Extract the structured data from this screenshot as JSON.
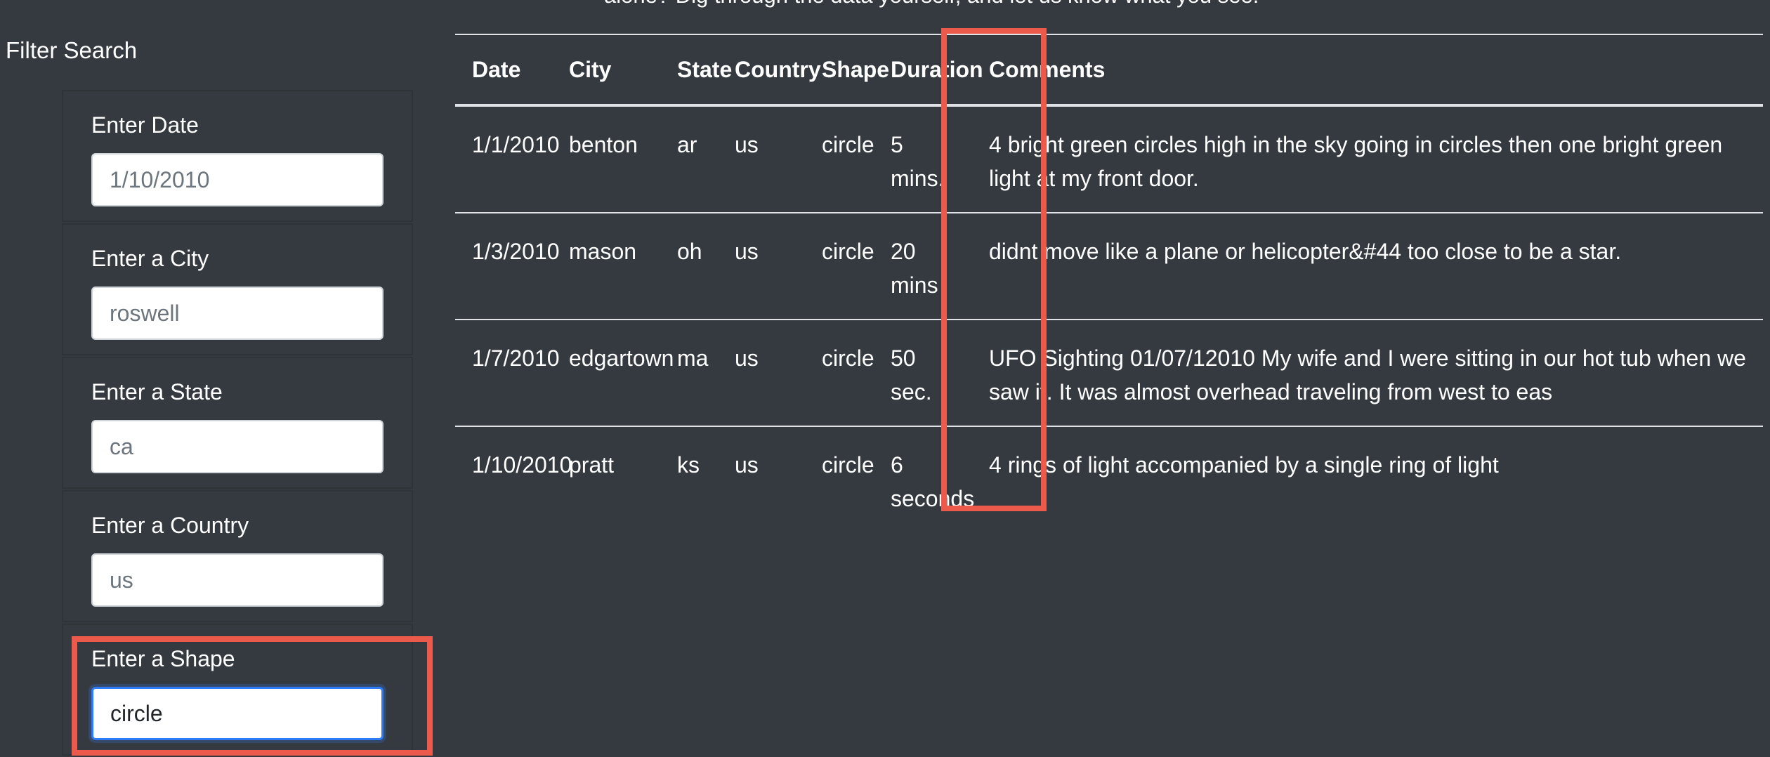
{
  "intro": {
    "partial_text": "alone? Dig through the data yourself, and let us know what you see."
  },
  "sidebar": {
    "title": "Filter Search",
    "filters": [
      {
        "label": "Enter Date",
        "placeholder": "1/10/2010",
        "value": ""
      },
      {
        "label": "Enter a City",
        "placeholder": "roswell",
        "value": ""
      },
      {
        "label": "Enter a State",
        "placeholder": "ca",
        "value": ""
      },
      {
        "label": "Enter a Country",
        "placeholder": "us",
        "value": ""
      },
      {
        "label": "Enter a Shape",
        "placeholder": "",
        "value": "circle"
      }
    ]
  },
  "table": {
    "headers": [
      "Date",
      "City",
      "State",
      "Country",
      "Shape",
      "Duration",
      "Comments"
    ],
    "rows": [
      [
        "1/1/2010",
        "benton",
        "ar",
        "us",
        "circle",
        "5 mins.",
        "4 bright green circles high in the sky going in circles then one bright green light at my front door."
      ],
      [
        "1/3/2010",
        "mason",
        "oh",
        "us",
        "circle",
        "20 mins",
        "didnt move like a plane or helicopter&#44 too close to be a star."
      ],
      [
        "1/7/2010",
        "edgartown",
        "ma",
        "us",
        "circle",
        "50 sec.",
        "UFO Sighting 01/07/12010 My wife and I were sitting in our hot tub when we saw it. It was almost overhead traveling from west to eas"
      ],
      [
        "1/10/2010",
        "pratt",
        "ks",
        "us",
        "circle",
        "6 seconds",
        "4 rings of light accompanied by a single ring of light"
      ]
    ]
  },
  "colors": {
    "background": "#343a40",
    "highlight": "#ec5a4b",
    "focus": "#2f7bf5"
  }
}
